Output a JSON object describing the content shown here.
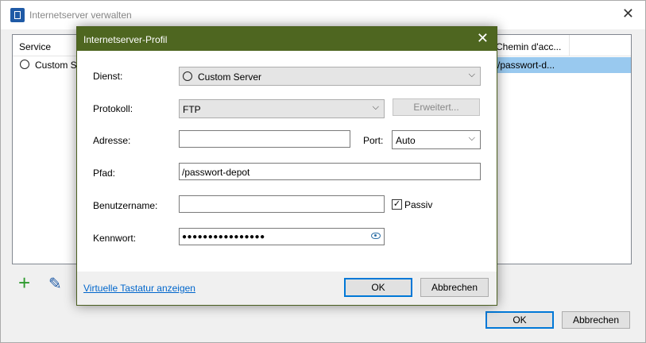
{
  "outer": {
    "title": "Internetserver verwalten",
    "columns": [
      "Service",
      "Chemin d'acc..."
    ],
    "row": {
      "service": "Custom S",
      "path": "/passwort-d..."
    },
    "ok": "OK",
    "cancel": "Abbrechen"
  },
  "dialog": {
    "title": "Internetserver-Profil",
    "dienst_label": "Dienst:",
    "dienst_value": "Custom Server",
    "protokoll_label": "Protokoll:",
    "protokoll_value": "FTP",
    "erweitert": "Erweitert...",
    "adresse_label": "Adresse:",
    "adresse_value": "",
    "port_label": "Port:",
    "port_value": "Auto",
    "pfad_label": "Pfad:",
    "pfad_value": "/passwort-depot",
    "benutzer_label": "Benutzername:",
    "benutzer_value": "",
    "passiv_label": "Passiv",
    "passiv_checked": "✓",
    "kennwort_label": "Kennwort:",
    "kennwort_value": "●●●●●●●●●●●●●●●●",
    "tastatur_link": "Virtuelle Tastatur anzeigen",
    "ok": "OK",
    "cancel": "Abbrechen"
  }
}
